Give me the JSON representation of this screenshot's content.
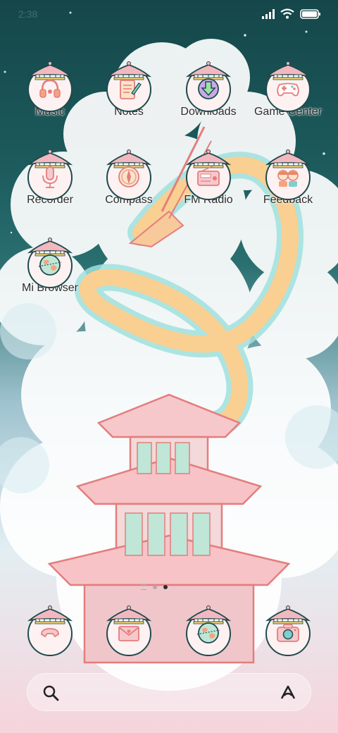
{
  "status_bar": {
    "time": "2:38",
    "signal_icon": "signal-icon",
    "wifi_icon": "wifi-icon",
    "battery_icon": "battery-icon"
  },
  "apps": {
    "music": {
      "label": "Music",
      "icon": "music-icon"
    },
    "notes": {
      "label": "Notes",
      "icon": "notes-icon"
    },
    "downloads": {
      "label": "Downloads",
      "icon": "downloads-icon"
    },
    "game_center": {
      "label": "Game Center",
      "icon": "gamepad-icon"
    },
    "recorder": {
      "label": "Recorder",
      "icon": "microphone-icon"
    },
    "compass": {
      "label": "Compass",
      "icon": "compass-icon"
    },
    "fm_radio": {
      "label": "FM Radio",
      "icon": "radio-icon"
    },
    "feedback": {
      "label": "Feedback",
      "icon": "feedback-icon"
    },
    "mi_browser": {
      "label": "Mi Browser",
      "icon": "globe-icon"
    }
  },
  "dock": [
    {
      "icon": "phone-icon"
    },
    {
      "icon": "mail-icon"
    },
    {
      "icon": "globe-icon"
    },
    {
      "icon": "camera-icon"
    }
  ],
  "page_indicator": {
    "pages": 2,
    "active": 2
  },
  "search_bar": {
    "search_icon": "search-icon",
    "assistant_icon": "assistant-icon"
  },
  "colors": {
    "sky_top": "#15474a",
    "cloud": "#ffffff",
    "pink": "#f6d4dc",
    "icon_outline": "#1f4a4c"
  }
}
